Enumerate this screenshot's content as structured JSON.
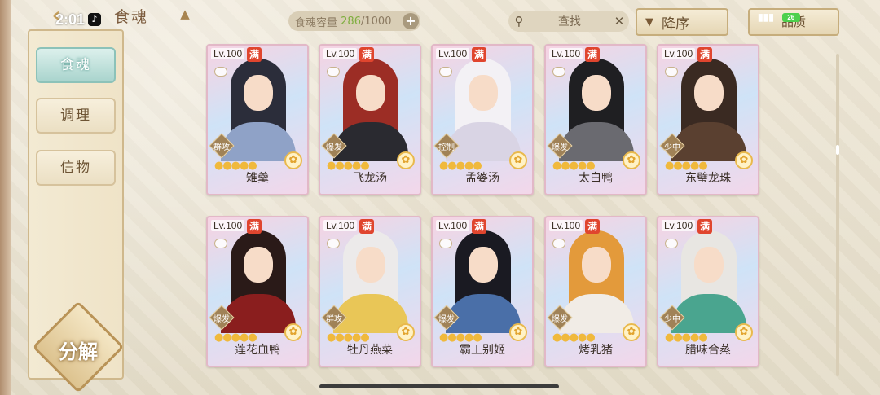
{
  "status": {
    "time": "2:01",
    "battery": "26"
  },
  "header": {
    "title": "食魂",
    "capacity_label": "食魂容量",
    "capacity_current": "286",
    "capacity_sep": "/",
    "capacity_max": "1000",
    "search_placeholder": "查找",
    "sort_label": "降序",
    "filter_label": "品质"
  },
  "sidebar": {
    "items": [
      {
        "label": "食魂",
        "active": true
      },
      {
        "label": "调理",
        "active": false
      },
      {
        "label": "信物",
        "active": false
      }
    ],
    "decompose_label": "分解"
  },
  "cards": [
    {
      "level": "Lv.100",
      "full": "满",
      "role": "群攻",
      "name": "雉羹",
      "stars": "●●●●●",
      "hair": "#2b2d3a",
      "robe": "#8fa2c7"
    },
    {
      "level": "Lv.100",
      "full": "满",
      "role": "爆发",
      "name": "飞龙汤",
      "stars": "●●●●●",
      "hair": "#9c2d25",
      "robe": "#2a2a30"
    },
    {
      "level": "Lv.100",
      "full": "满",
      "role": "控制",
      "name": "孟婆汤",
      "stars": "●●●●●",
      "hair": "#f3f1f5",
      "robe": "#d9d4e4"
    },
    {
      "level": "Lv.100",
      "full": "满",
      "role": "爆发",
      "name": "太白鸭",
      "stars": "●●●●●",
      "hair": "#1f1f22",
      "robe": "#6a6a70"
    },
    {
      "level": "Lv.100",
      "full": "满",
      "role": "少中",
      "name": "东璧龙珠",
      "stars": "●●●●●",
      "hair": "#3a2a22",
      "robe": "#5a4030"
    },
    {
      "level": "Lv.100",
      "full": "满",
      "role": "爆发",
      "name": "莲花血鸭",
      "stars": "●●●●●",
      "hair": "#2a1a18",
      "robe": "#8a1e1e"
    },
    {
      "level": "Lv.100",
      "full": "满",
      "role": "群攻",
      "name": "牡丹燕菜",
      "stars": "●●●●●",
      "hair": "#eceaea",
      "robe": "#e9c657"
    },
    {
      "level": "Lv.100",
      "full": "满",
      "role": "爆发",
      "name": "霸王别姬",
      "stars": "●●●●●",
      "hair": "#1a1a22",
      "robe": "#4a6fa8"
    },
    {
      "level": "Lv.100",
      "full": "满",
      "role": "爆发",
      "name": "烤乳猪",
      "stars": "●●●●●",
      "hair": "#e39a3b",
      "robe": "#f1ece6"
    },
    {
      "level": "Lv.100",
      "full": "满",
      "role": "少中",
      "name": "腊味合蒸",
      "stars": "●●●●●",
      "hair": "#e8e6e2",
      "robe": "#4aa58f"
    }
  ]
}
